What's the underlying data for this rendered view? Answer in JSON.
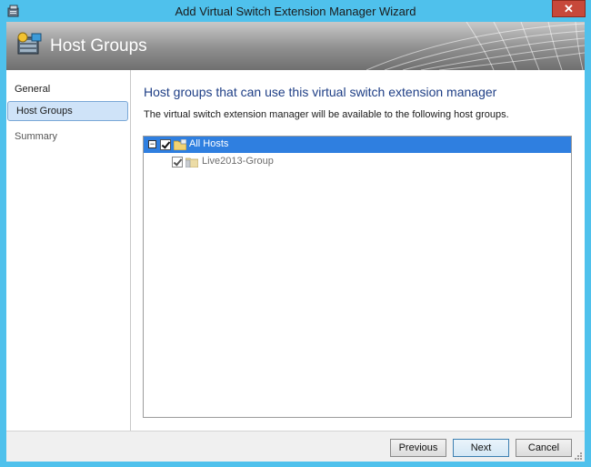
{
  "window": {
    "title": "Add Virtual Switch Extension Manager Wizard",
    "close_glyph": "✕",
    "app_icon": "wizard-app-icon"
  },
  "header": {
    "title": "Host Groups",
    "icon": "host-groups-icon"
  },
  "sidebar": {
    "items": [
      {
        "label": "General"
      },
      {
        "label": "Host Groups"
      },
      {
        "label": "Summary"
      }
    ],
    "selected_index": 1
  },
  "main": {
    "heading": "Host groups that can use this virtual switch extension manager",
    "description": "The virtual switch extension manager will be available to the following host groups.",
    "tree": [
      {
        "label": "All Hosts",
        "checked": true,
        "expanded": true,
        "selected": true,
        "expander_glyph": "−"
      },
      {
        "label": "Live2013-Group",
        "checked": true,
        "selected": false
      }
    ]
  },
  "footer": {
    "previous_label": "Previous",
    "next_label": "Next",
    "cancel_label": "Cancel"
  },
  "colors": {
    "selection": "#2f7fe0",
    "heading": "#1f3f86",
    "titlebar": "#4fc1ec"
  }
}
